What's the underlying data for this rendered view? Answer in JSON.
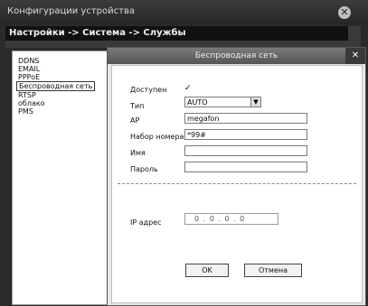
{
  "window": {
    "title": "Конфигурации устройства"
  },
  "breadcrumb": "Настройки -> Система -> Службы",
  "services_list": [
    "DDNS",
    "EMAIL",
    "PPPoE",
    "Беспроводная сеть",
    "RTSP",
    "облако",
    "PMS"
  ],
  "selected_service": "Беспроводная сеть",
  "dialog": {
    "title": "Беспроводная сеть",
    "close_glyph": "✕",
    "enabled_label": "Доступен",
    "enabled_checked": true,
    "check_glyph": "✓",
    "type_label": "Тип",
    "type_value": "AUTO",
    "ap_label": "AP",
    "ap_value": "megafon",
    "dial_label": "Набор номера",
    "dial_value": "*99#",
    "name_label": "Имя",
    "name_value": "",
    "password_label": "Пароль",
    "password_value": "",
    "ip_label": "IP адрес",
    "ip_value": "0 . 0 . 0 . 0",
    "ok_label": "OK",
    "cancel_label": "Отмена"
  },
  "icons": {
    "window_close": "close-circle-icon",
    "dropdown": "chevron-down-icon"
  }
}
